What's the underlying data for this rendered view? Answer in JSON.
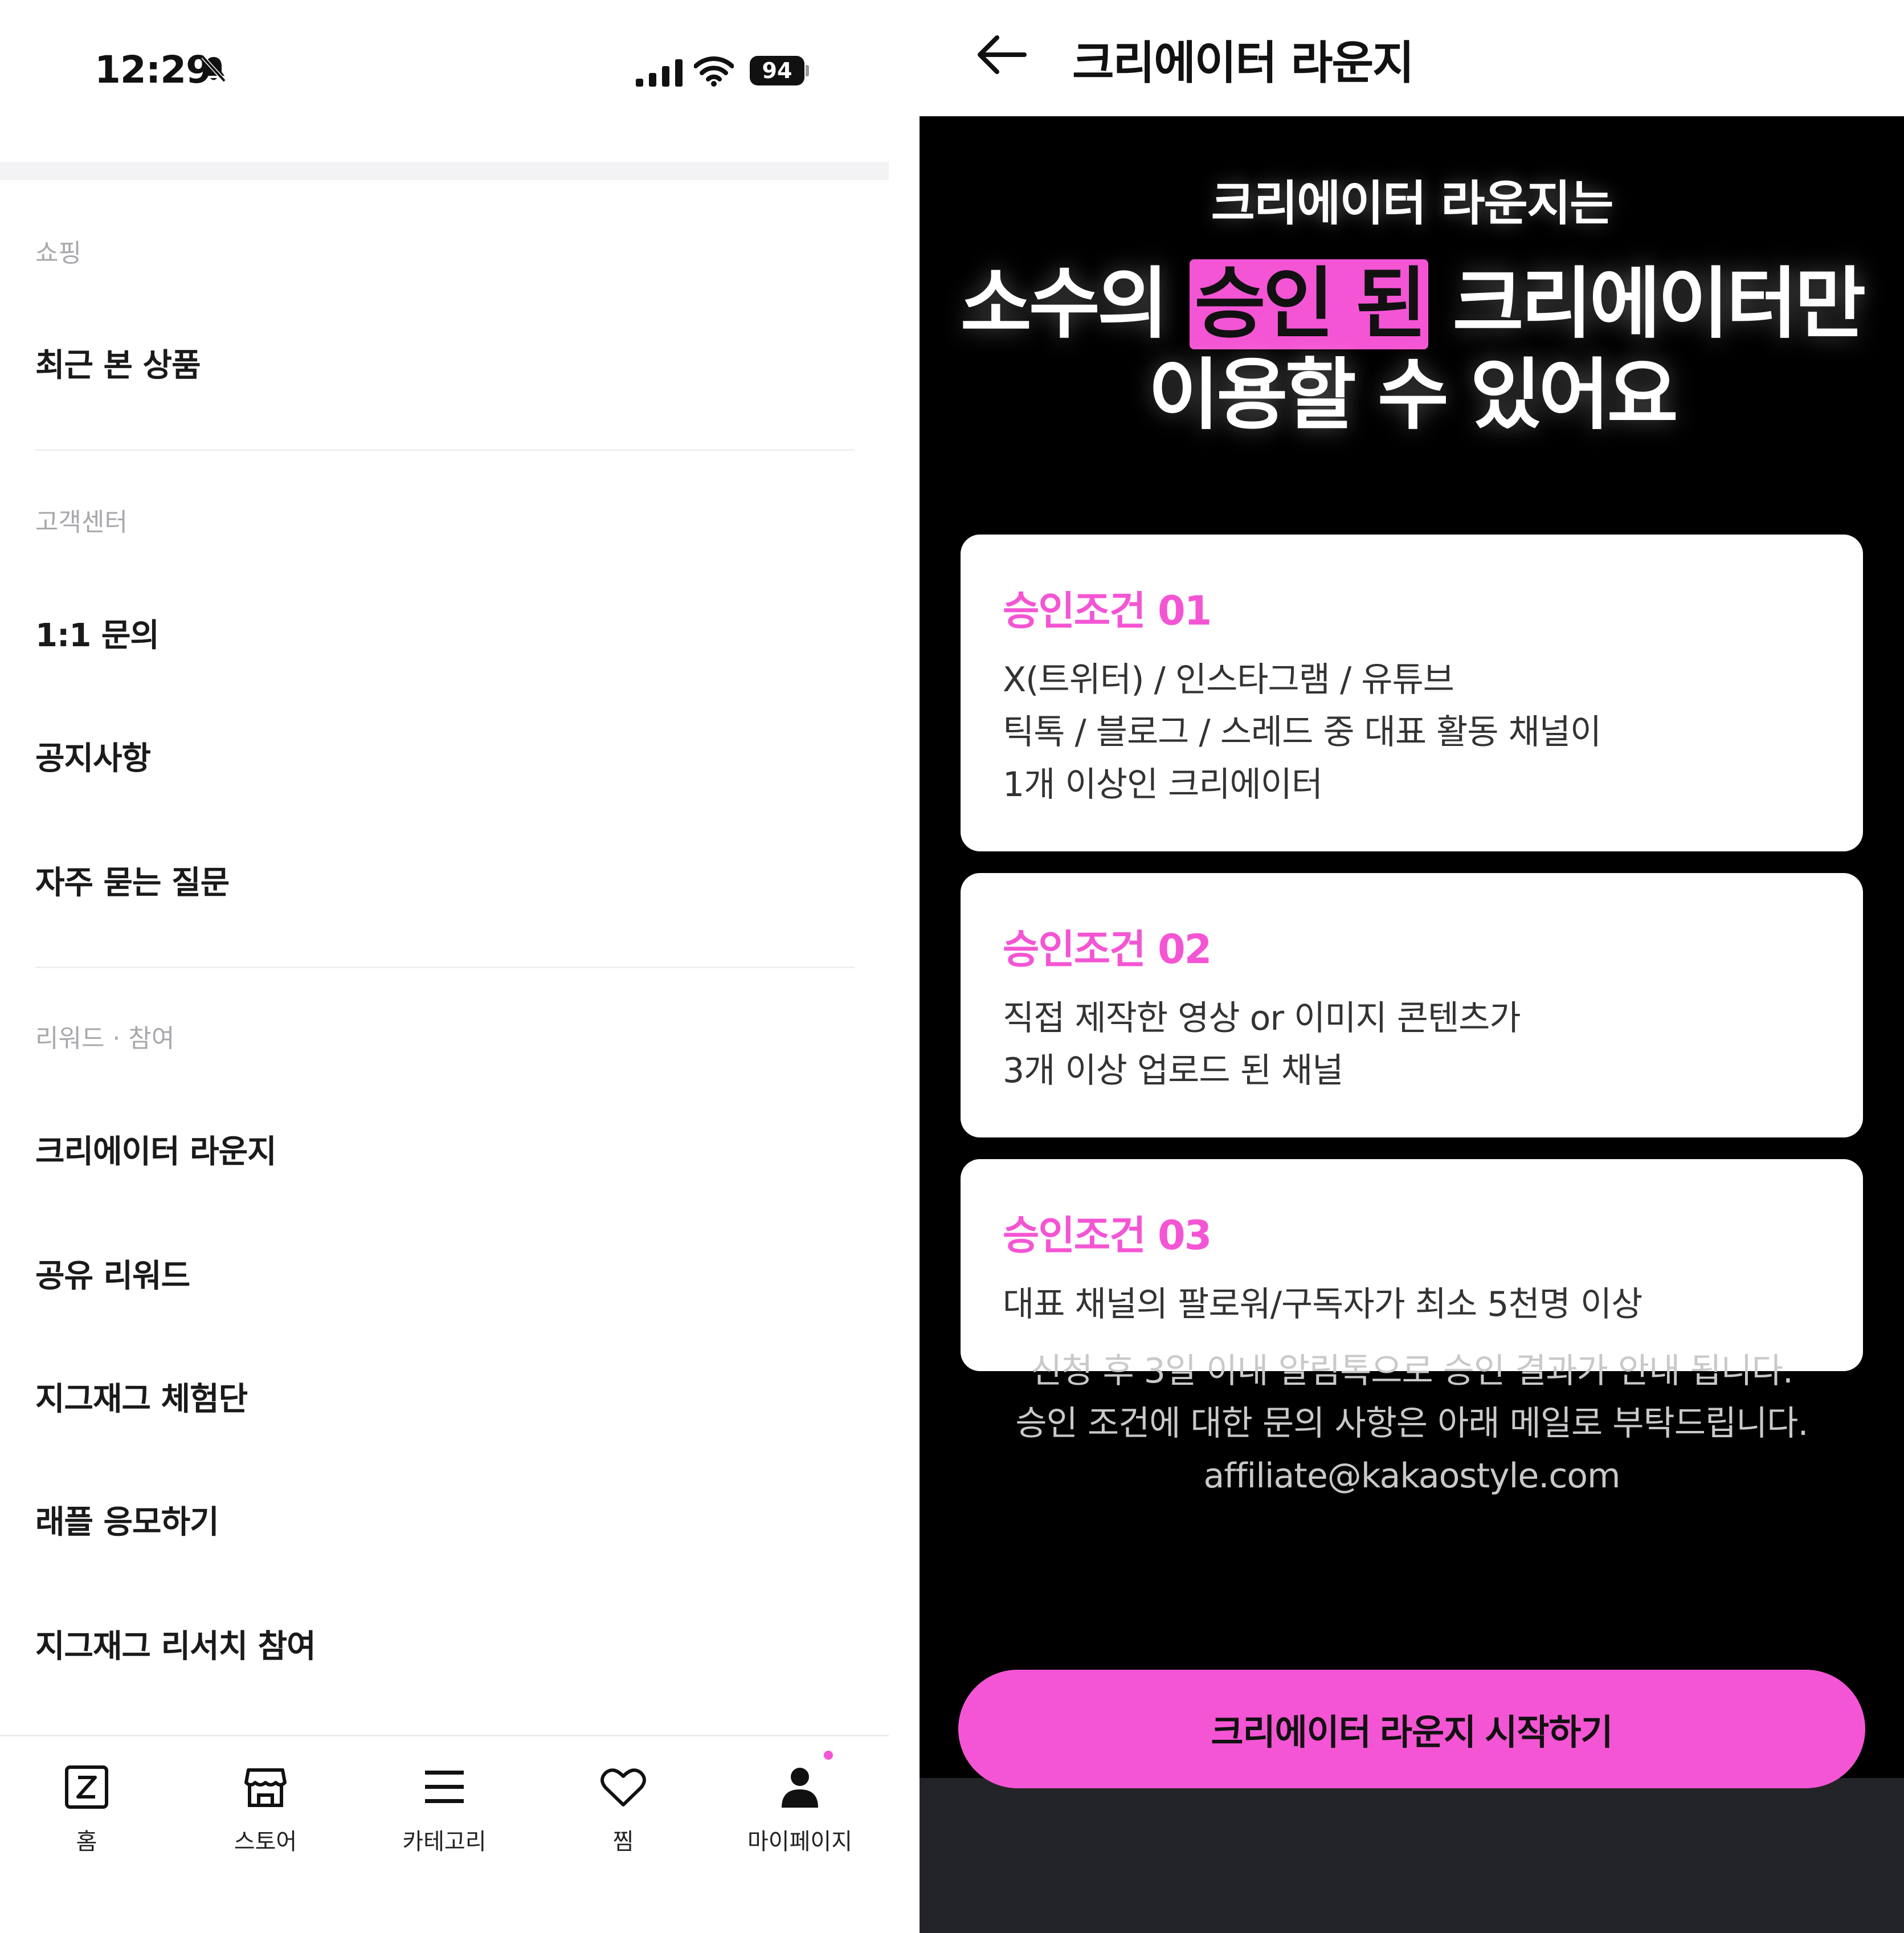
{
  "left": {
    "status_bar": {
      "time": "12:29",
      "battery": "94"
    },
    "sections": [
      {
        "label": "쇼핑",
        "items": [
          "최근 본 상품"
        ]
      },
      {
        "label": "고객센터",
        "items": [
          "1:1 문의",
          "공지사항",
          "자주 묻는 질문"
        ]
      },
      {
        "label": "리워드 · 참여",
        "items": [
          "크리에이터 라운지",
          "공유 리워드",
          "지그재그 체험단",
          "래플 응모하기",
          "지그재그 리서치 참여"
        ]
      }
    ],
    "tabs": [
      "홈",
      "스토어",
      "카테고리",
      "찜",
      "마이페이지"
    ]
  },
  "right": {
    "header": {
      "title": "크리에이터 라운지"
    },
    "hero": {
      "subtitle": "크리에이터 라운지는",
      "line1_before": "소수의 ",
      "line1_highlight": "승인 된",
      "line1_after": " 크리에이터만",
      "line2": "이용할 수 있어요"
    },
    "cards": [
      {
        "title": "승인조건 01",
        "lines": [
          "X(트위터) / 인스타그램 / 유튜브",
          "틱톡 / 블로그 / 스레드 중 대표 활동 채널이",
          "1개 이상인 크리에이터"
        ]
      },
      {
        "title": "승인조건 02",
        "lines": [
          "직접 제작한 영상 or 이미지 콘텐츠가",
          "3개 이상 업로드 된 채널"
        ]
      },
      {
        "title": "승인조건 03",
        "lines": [
          "대표 채널의 팔로워/구독자가 최소 5천명 이상"
        ]
      }
    ],
    "notice": [
      "신청 후 3일 이내 알림톡으로 승인 결과가 안내 됩니다.",
      "승인 조건에 대한 문의 사항은 아래 메일로 부탁드립니다.",
      "affiliate@kakaostyle.com"
    ],
    "cta_label": "크리에이터 라운지 시작하기"
  },
  "colors": {
    "accent": "#f455d4",
    "dark_bg": "#000000",
    "bottom_bar": "#232427"
  }
}
